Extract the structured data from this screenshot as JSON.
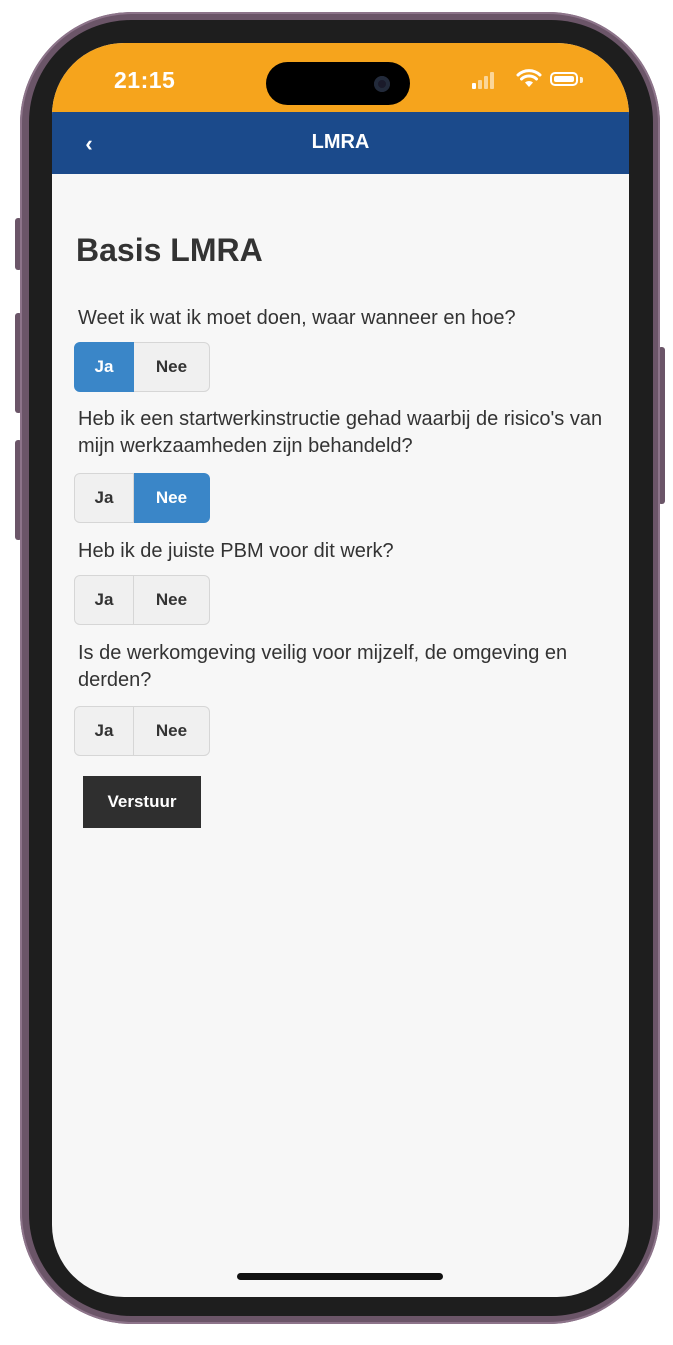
{
  "status_bar": {
    "time": "21:15",
    "icons": [
      "cellular-signal-icon",
      "wifi-icon",
      "battery-icon"
    ],
    "color": "#f6a41c"
  },
  "nav": {
    "back_icon": "‹",
    "title": "LMRA",
    "color": "#1b4a8b"
  },
  "page": {
    "title": "Basis LMRA",
    "questions": [
      {
        "text": "Weet ik wat ik moet doen, waar wanneer en hoe?",
        "options": [
          "Ja",
          "Nee"
        ],
        "selected": "Ja"
      },
      {
        "text": "Heb ik een startwerkinstructie gehad waarbij de risico's van mijn werkzaamheden zijn behandeld?",
        "options": [
          "Ja",
          "Nee"
        ],
        "selected": "Nee"
      },
      {
        "text": "Heb ik de juiste PBM voor dit werk?",
        "options": [
          "Ja",
          "Nee"
        ],
        "selected": null
      },
      {
        "text": "Is de werkomgeving veilig voor mijzelf, de omgeving en derden?",
        "options": [
          "Ja",
          "Nee"
        ],
        "selected": null
      }
    ],
    "submit_label": "Verstuur",
    "accent_color": "#3a86c8"
  }
}
